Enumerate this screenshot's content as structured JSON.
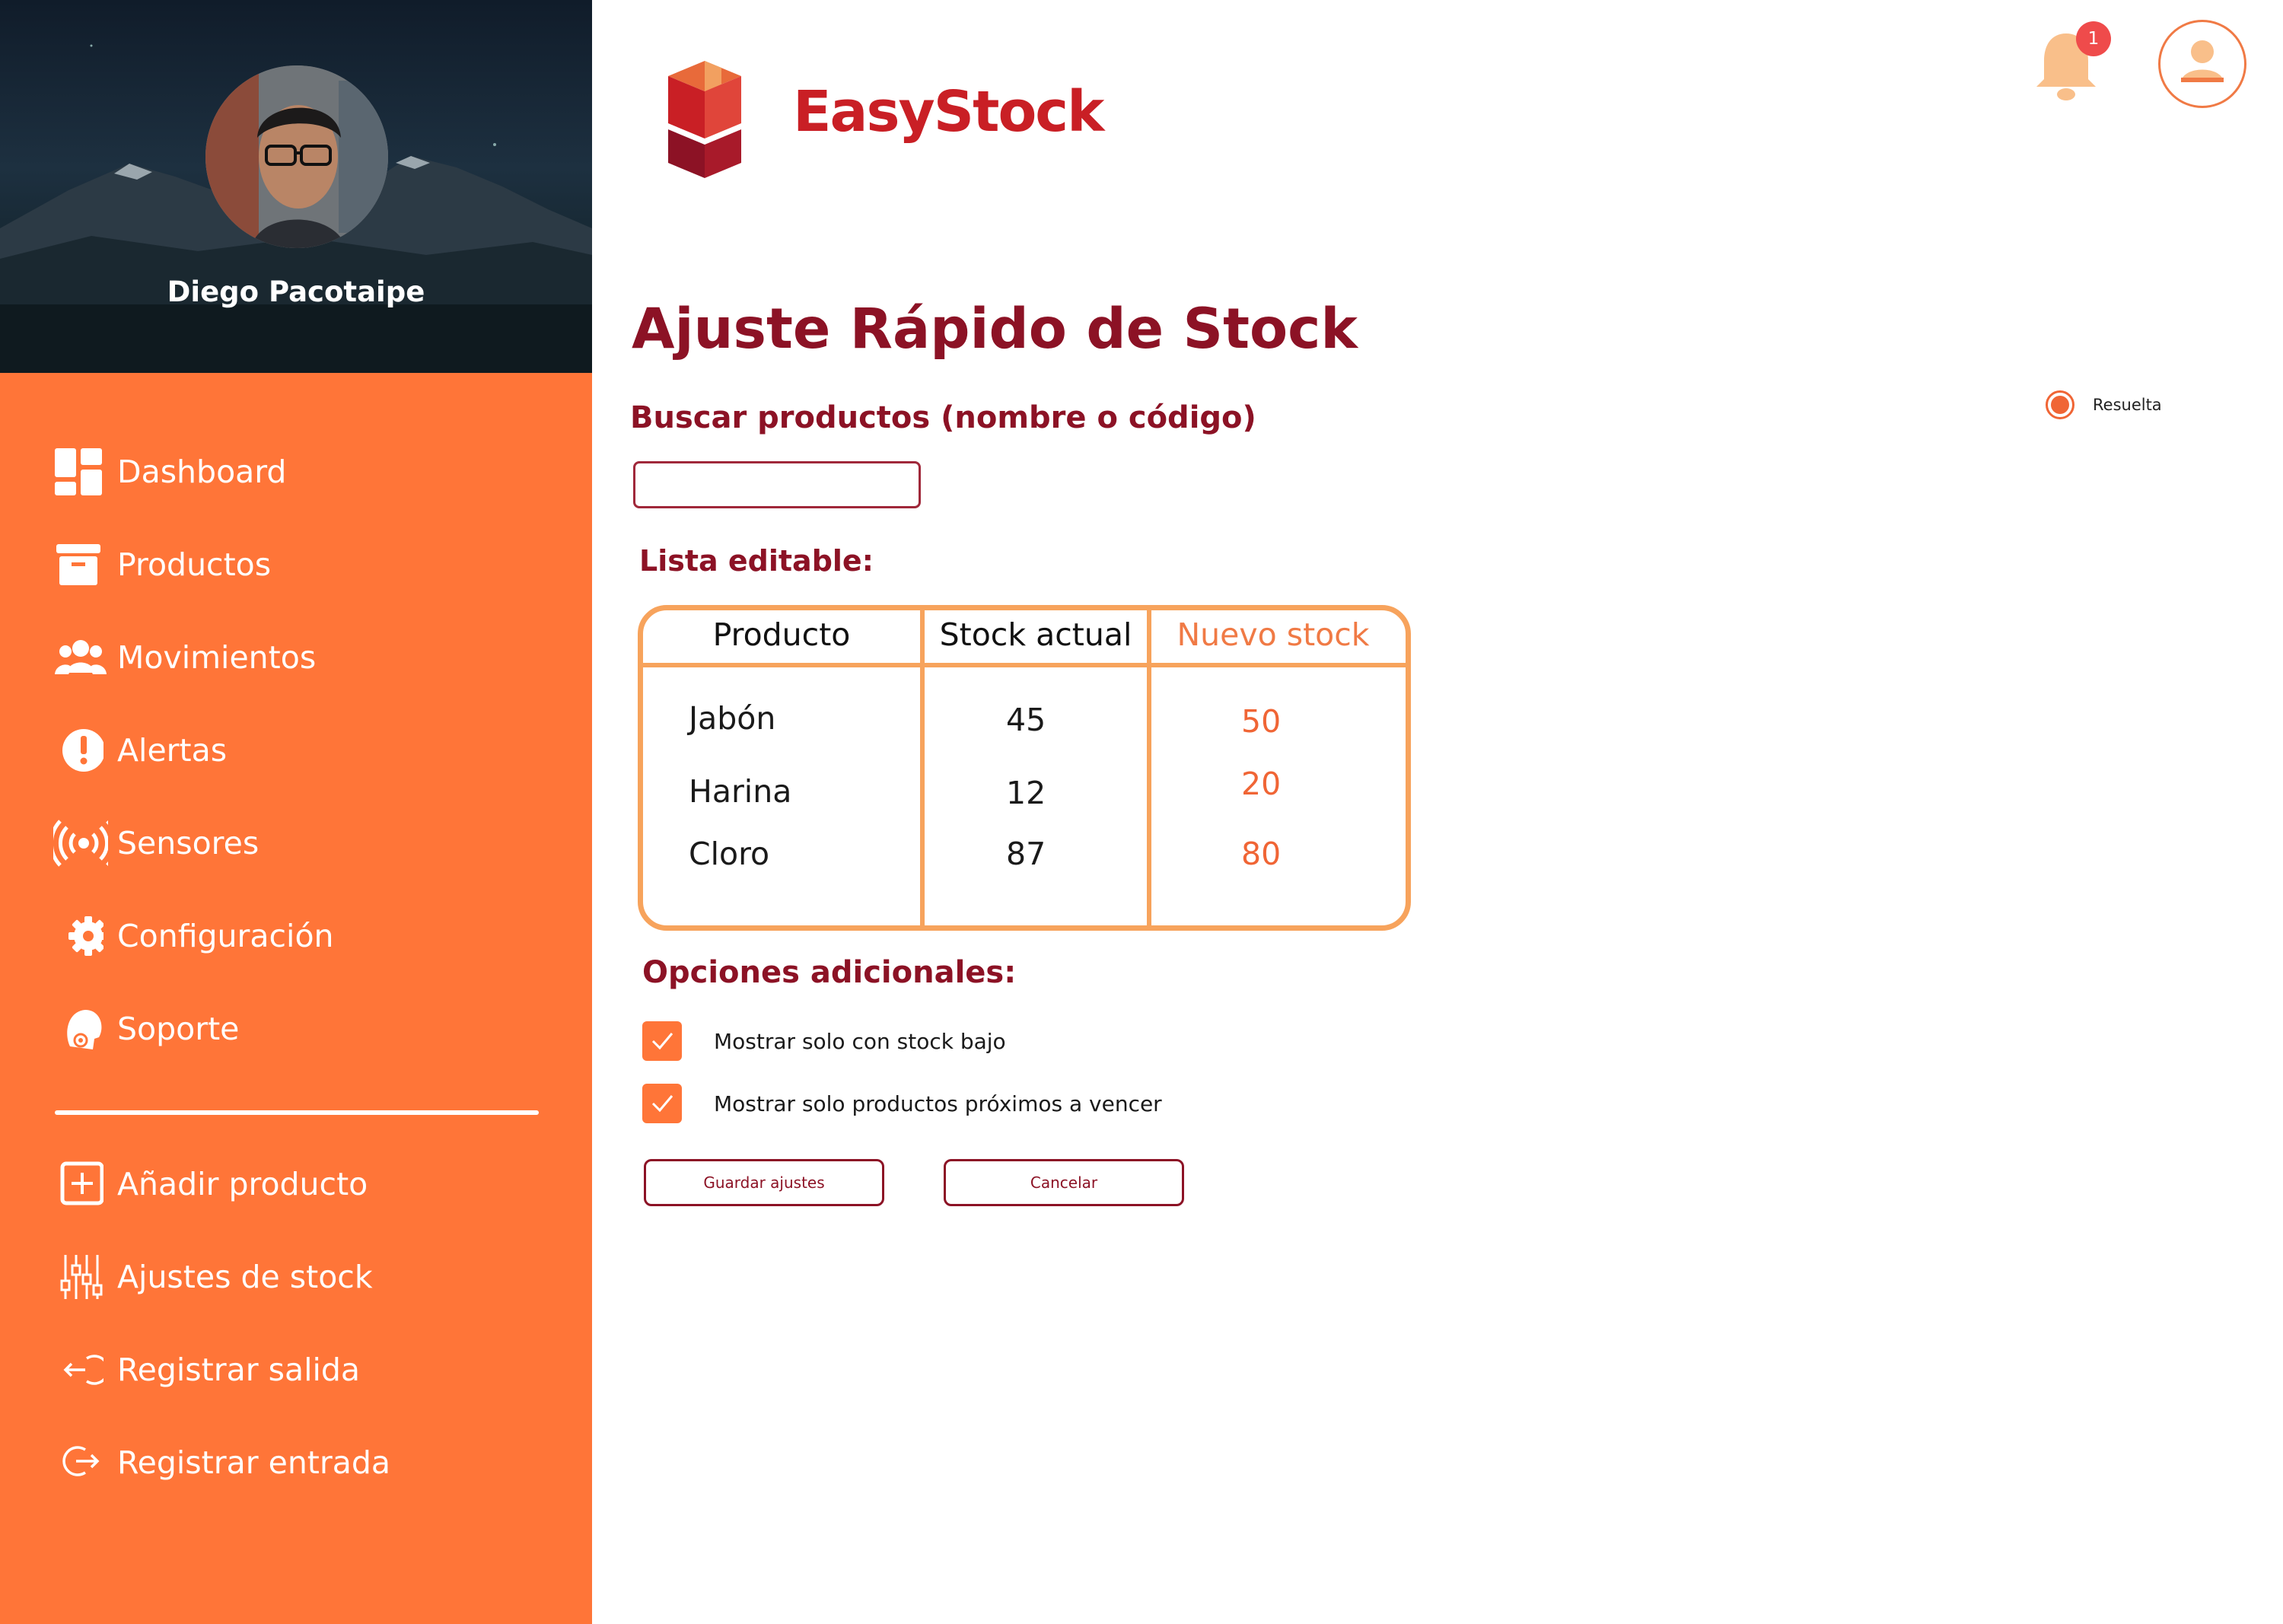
{
  "colors": {
    "sidebar": "#ff7538",
    "heading": "#8c1225",
    "brand": "#c91f25",
    "accent": "#f06535",
    "table_border": "#f7a35c"
  },
  "profile": {
    "name": "Diego Pacotaipe"
  },
  "nav": {
    "items": [
      {
        "label": "Dashboard",
        "icon": "dashboard-icon"
      },
      {
        "label": "Productos",
        "icon": "archive-box-icon"
      },
      {
        "label": "Movimientos",
        "icon": "users-icon"
      },
      {
        "label": "Alertas",
        "icon": "alert-icon"
      },
      {
        "label": "Sensores",
        "icon": "sensor-broadcast-icon"
      },
      {
        "label": "Configuración",
        "icon": "gear-icon"
      },
      {
        "label": "Soporte",
        "icon": "support-headset-icon"
      }
    ],
    "actions": [
      {
        "label": "Añadir producto",
        "icon": "add-square-icon"
      },
      {
        "label": "Ajustes de stock",
        "icon": "sliders-icon"
      },
      {
        "label": "Registrar salida",
        "icon": "logout-arrow-icon"
      },
      {
        "label": "Registrar entrada",
        "icon": "login-arrow-icon"
      }
    ]
  },
  "header": {
    "brand": "EasyStock",
    "notification_count": "1"
  },
  "main": {
    "title": "Ajuste Rápido de Stock",
    "search_label": "Buscar productos (nombre o código)",
    "search_value": "",
    "list_label": "Lista editable:",
    "status_option": "Resuelta",
    "table": {
      "headers": [
        "Producto",
        "Stock actual",
        "Nuevo stock"
      ],
      "rows": [
        {
          "product": "Jabón",
          "current": "45",
          "new": "50"
        },
        {
          "product": "Harina",
          "current": "12",
          "new": "20"
        },
        {
          "product": "Cloro",
          "current": "87",
          "new": "80"
        }
      ]
    },
    "options_label": "Opciones adicionales:",
    "options": [
      {
        "label": "Mostrar solo con stock bajo",
        "checked": true
      },
      {
        "label": "Mostrar solo productos próximos a vencer",
        "checked": true
      }
    ],
    "save_button": "Guardar ajustes",
    "cancel_button": "Cancelar"
  }
}
